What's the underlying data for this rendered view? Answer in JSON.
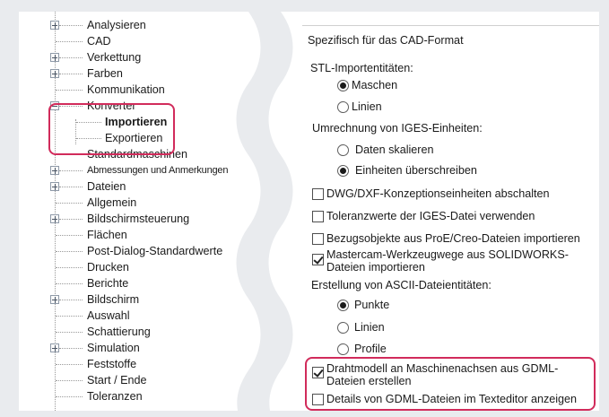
{
  "tree": {
    "items": [
      {
        "label": "Analysieren"
      },
      {
        "label": "CAD"
      },
      {
        "label": "Verkettung"
      },
      {
        "label": "Farben"
      },
      {
        "label": "Kommunikation"
      },
      {
        "label": "Konverter"
      },
      {
        "label": "Importieren"
      },
      {
        "label": "Exportieren"
      },
      {
        "label": "Standardmaschinen"
      },
      {
        "label": "Abmessungen und Anmerkungen"
      },
      {
        "label": "Dateien"
      },
      {
        "label": "Allgemein"
      },
      {
        "label": "Bildschirmsteuerung"
      },
      {
        "label": "Flächen"
      },
      {
        "label": "Post-Dialog-Standardwerte"
      },
      {
        "label": "Drucken"
      },
      {
        "label": "Berichte"
      },
      {
        "label": "Bildschirm"
      },
      {
        "label": "Auswahl"
      },
      {
        "label": "Schattierung"
      },
      {
        "label": "Simulation"
      },
      {
        "label": "Feststoffe"
      },
      {
        "label": "Start / Ende"
      },
      {
        "label": "Toleranzen"
      }
    ]
  },
  "panel": {
    "section_title": "Spezifisch für das CAD-Format",
    "stl_label": "STL-Importentitäten:",
    "stl_options": [
      {
        "label": "Maschen",
        "checked": true
      },
      {
        "label": "Linien",
        "checked": false
      }
    ],
    "iges_label": "Umrechnung von IGES-Einheiten:",
    "iges_options": [
      {
        "label": "Daten skalieren",
        "checked": false
      },
      {
        "label": "Einheiten überschreiben",
        "checked": true
      }
    ],
    "checkboxes": [
      {
        "label": "DWG/DXF-Konzeptionseinheiten abschalten",
        "checked": false
      },
      {
        "label": "Toleranzwerte der IGES-Datei verwenden",
        "checked": false
      },
      {
        "label": "Bezugsobjekte aus ProE/Creo-Dateien importieren",
        "checked": false
      },
      {
        "label": "Mastercam-Werkzeugwege aus SOLIDWORKS-",
        "label2": "Dateien importieren",
        "checked": true
      }
    ],
    "ascii_label": "Erstellung von ASCII-Dateientitäten:",
    "ascii_options": [
      {
        "label": "Punkte",
        "checked": true
      },
      {
        "label": "Linien",
        "checked": false
      },
      {
        "label": "Profile",
        "checked": false
      }
    ],
    "gdml": [
      {
        "label": "Drahtmodell an Maschinenachsen aus GDML-",
        "label2": "Dateien erstellen",
        "checked": true
      },
      {
        "label": "Details von GDML-Dateien im Texteditor anzeigen",
        "checked": false
      }
    ]
  },
  "colors": {
    "highlight": "#d12b5b",
    "background": "#e9ebee"
  }
}
